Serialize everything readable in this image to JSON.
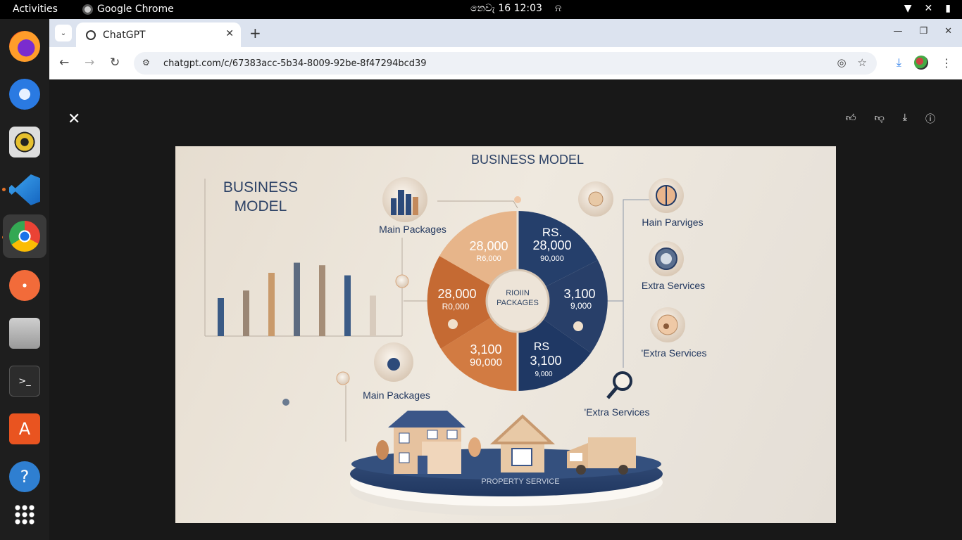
{
  "system_bar": {
    "activities": "Activities",
    "app_name": "Google Chrome",
    "clock": "නෙවැ 16  12:03"
  },
  "browser": {
    "tab_title": "ChatGPT",
    "url": "chatgpt.com/c/67383acc-5b34-8009-92be-8f47294bcd39"
  },
  "infographic": {
    "top_title": "BUSINESS MODEL",
    "left_title_line1": "BUSINESS",
    "left_title_line2": "MODEL",
    "main_packages_top": "Main Packages",
    "main_packages_bottom": "Main Packages",
    "hain_parviges": "Hain Parviges",
    "extra_services_1": "Extra Services",
    "extra_services_2": "'Extra Services",
    "extra_services_3": "'Extra Services",
    "center_line1": "RIOIIN",
    "center_line2": "PACKAGES",
    "seg_top_left_big": "28,000",
    "seg_top_left_small": "R6,000",
    "seg_top_right_line1": "RS.",
    "seg_top_right_big": "28,000",
    "seg_top_right_small": "90,000",
    "seg_left_big": "28,000",
    "seg_left_small": "R0,000",
    "seg_right_big": "3,100",
    "seg_right_small": "9,000",
    "seg_bottom_left_big": "3,100",
    "seg_bottom_left_small": "90,000",
    "seg_bottom_right_line1": "RS",
    "seg_bottom_right_big": "3,100",
    "seg_bottom_right_small": "9,000",
    "platform_label": "PROPERTY SERVICE"
  },
  "chart_data": {
    "type": "bar",
    "title": "",
    "categories": [
      "",
      "",
      "",
      "",
      "",
      "",
      ""
    ],
    "values": [
      30,
      36,
      50,
      58,
      56,
      48,
      32
    ],
    "ylim": [
      0,
      100
    ],
    "colors": [
      "#3a5a85",
      "#9a8674",
      "#c99a6b",
      "#5d6b80",
      "#a58d77",
      "#3b5b86",
      "#d8cbbd"
    ]
  },
  "colors": {
    "navy": "#253f6b",
    "orange": "#c8703a",
    "peach": "#e7b58a",
    "background": "#e6ddd0"
  }
}
